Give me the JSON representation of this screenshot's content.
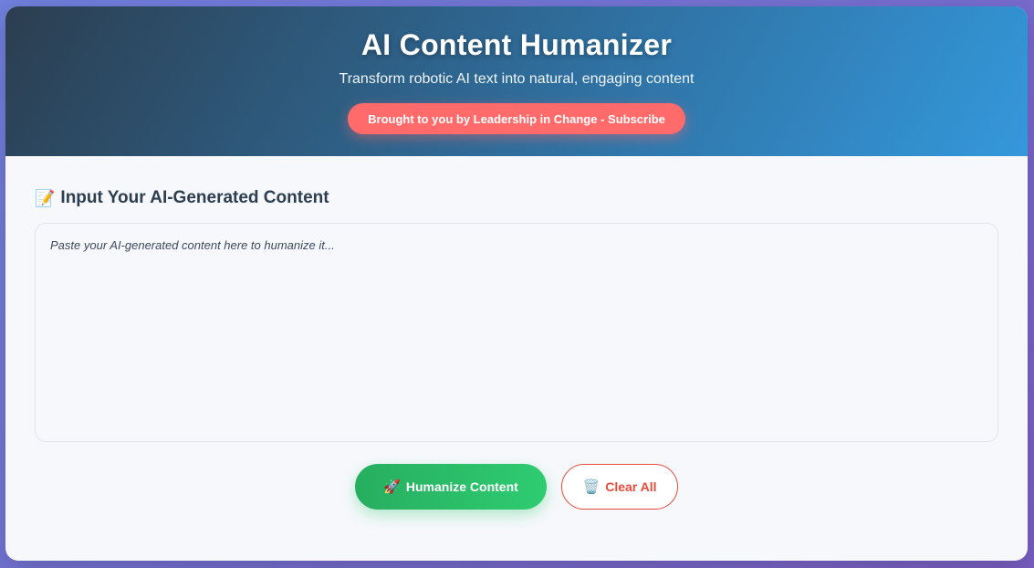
{
  "header": {
    "title": "AI Content Humanizer",
    "subtitle": "Transform robotic AI text into natural, engaging content",
    "promo_label": "Brought to you by Leadership in Change - Subscribe"
  },
  "input_section": {
    "icon": "memo-icon",
    "icon_glyph": "📝",
    "title": "Input Your AI-Generated Content",
    "placeholder": "Paste your AI-generated content here to humanize it...",
    "value": ""
  },
  "actions": {
    "humanize": {
      "icon": "rocket-icon",
      "icon_glyph": "🚀",
      "label": "Humanize Content"
    },
    "clear": {
      "icon": "trash-icon",
      "icon_glyph": "🗑️",
      "label": "Clear All"
    }
  },
  "colors": {
    "header_start": "#2c3e50",
    "header_end": "#3498db",
    "promo": "#ff6b6b",
    "primary_start": "#27ae60",
    "primary_end": "#2ecc71",
    "danger": "#e74c3c",
    "page_bg_start": "#6f7fdc",
    "page_bg_end": "#7b5fc4"
  }
}
